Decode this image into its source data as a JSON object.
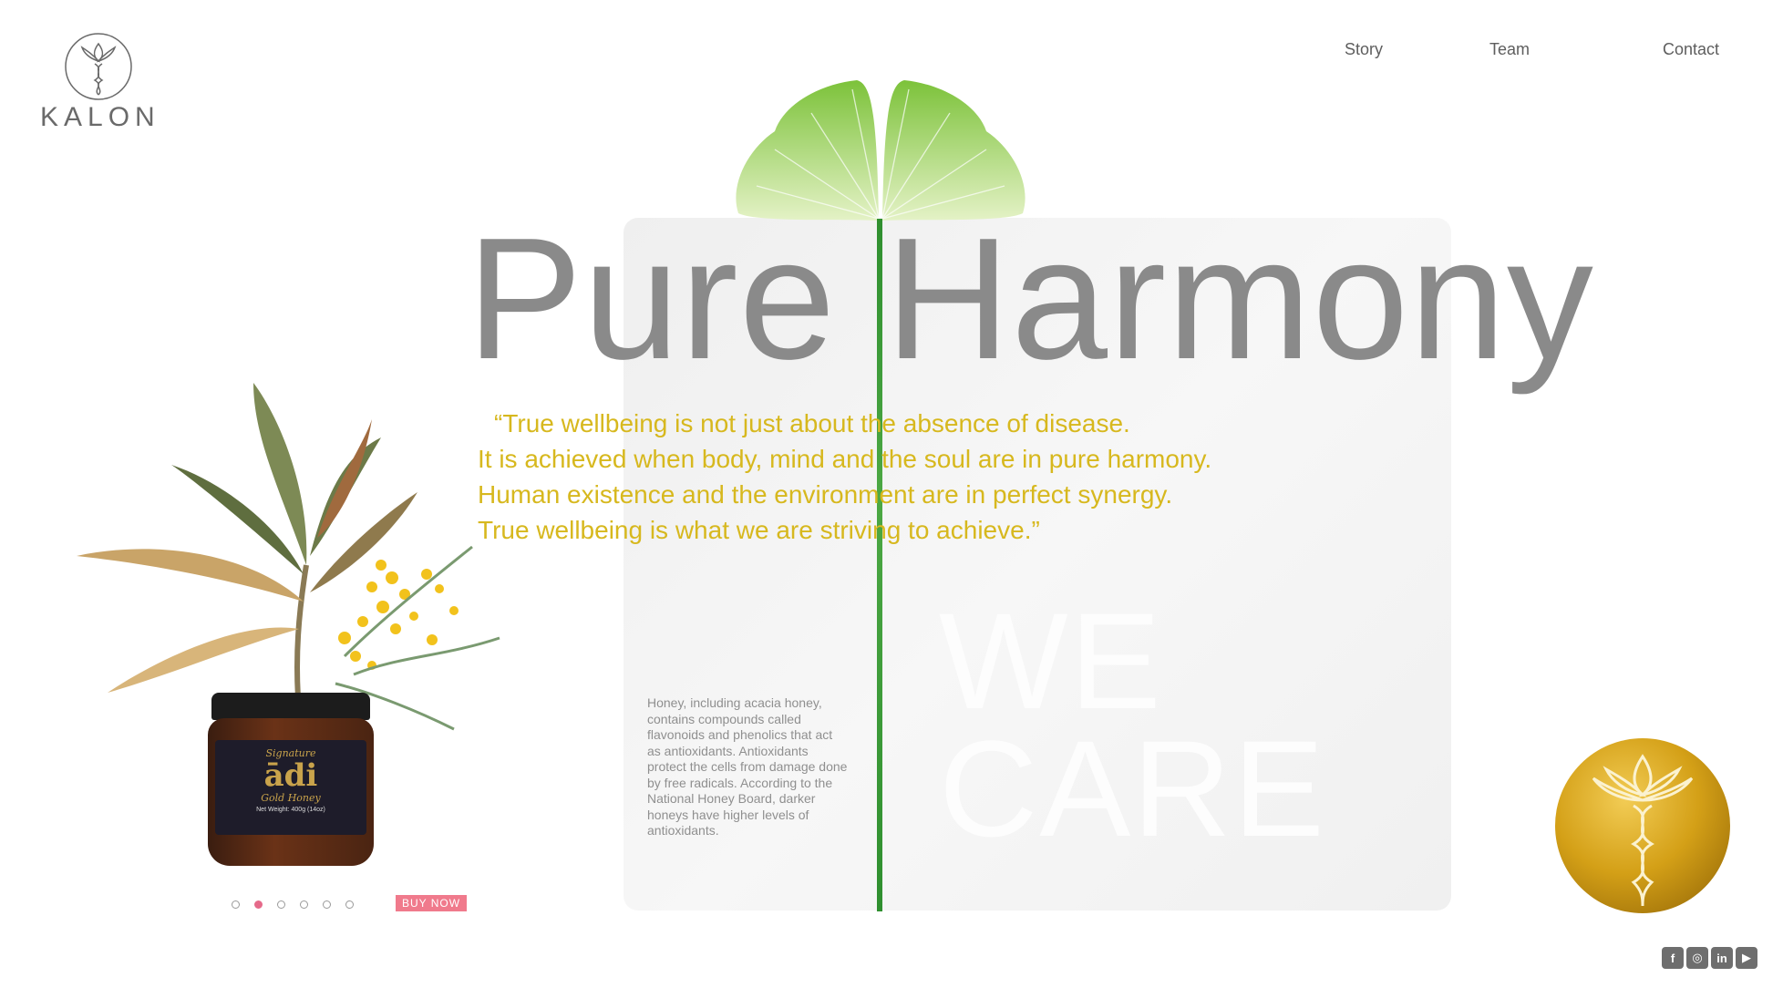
{
  "brand": {
    "name": "KALON"
  },
  "nav": {
    "story": "Story",
    "team": "Team",
    "contact": "Contact"
  },
  "hero": {
    "headline": "Pure Harmony",
    "quote": [
      "“True wellbeing is not just about the absence of disease.",
      "It is achieved when body, mind and the soul are in pure harmony.",
      "Human existence and the environment are in perfect synergy.",
      "True wellbeing is what we are striving to achieve.”"
    ],
    "watermark": [
      "WE",
      "CARE"
    ],
    "info": "Honey, including acacia honey, contains compounds called flavonoids and phenolics that act as antioxidants. Antioxidants protect the cells from damage done by free radicals. According to the National Honey Board, darker honeys have higher levels of antioxidants."
  },
  "product": {
    "label_sig": "Signature",
    "label_brand": "ādi",
    "label_kind": "Gold Honey",
    "label_weight": "Net Weight: 400g (14oz)",
    "buy_label": "BUY NOW",
    "carousel": {
      "count": 6,
      "active_index": 1
    }
  },
  "social": {
    "facebook": "f",
    "instagram": "◎",
    "linkedin": "in",
    "youtube": "▶"
  },
  "colors": {
    "accent_quote": "#d7b81e",
    "headline": "#8a8a8a",
    "buy_button": "#f07a8c",
    "medal_gold": "#d4a017",
    "stem_green": "#4ca844"
  }
}
